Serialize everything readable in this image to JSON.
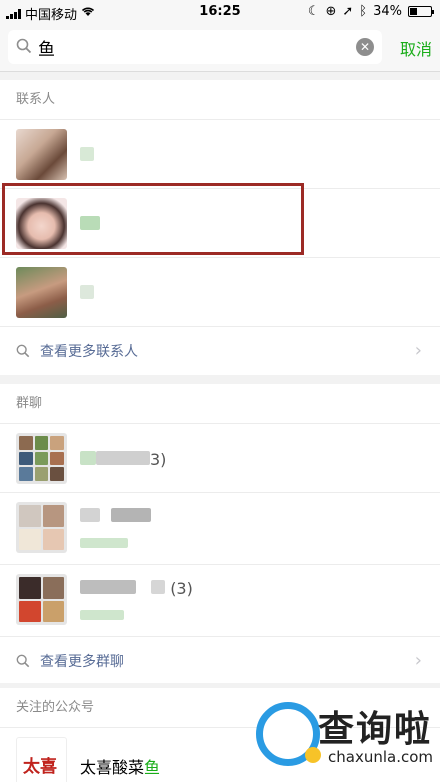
{
  "status_bar": {
    "carrier": "中国移动",
    "time": "16:25",
    "battery": "34%",
    "battery_level": 0.34
  },
  "search": {
    "query": "鱼",
    "cancel_label": "取消"
  },
  "contacts": {
    "title": "联系人",
    "more_label": "查看更多联系人"
  },
  "groups": {
    "title": "群聊",
    "more_label": "查看更多群聊",
    "items": [
      {
        "count": "3)"
      },
      {
        "count": ""
      },
      {
        "count": "(3)"
      }
    ]
  },
  "official_accounts": {
    "title": "关注的公众号",
    "item_name_prefix": "太喜酸菜",
    "item_name_match": "鱼",
    "logo_text": "太喜"
  },
  "watermark": {
    "cn": "查询啦",
    "en": "chaxunla.com"
  },
  "colors": {
    "accent_green": "#1aad19",
    "link_blue": "#576b95",
    "highlight_red": "#9c2a25"
  }
}
